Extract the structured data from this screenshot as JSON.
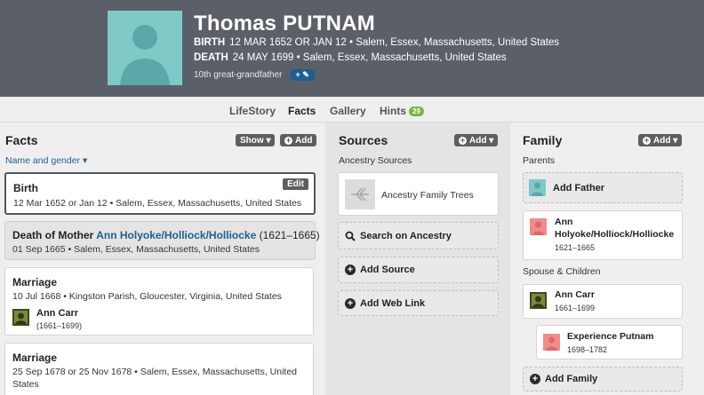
{
  "person": {
    "name": "Thomas PUTNAM",
    "birth_label": "BIRTH",
    "birth_value": "12 MAR 1652 OR JAN 12 • Salem, Essex, Massachusetts, United States",
    "death_label": "DEATH",
    "death_value": "24 MAY 1699 • Salem, Essex, Massachusetts, United States",
    "relationship": "10th great-grandfather",
    "relationship_button": "+ ✎"
  },
  "tabs": [
    {
      "label": "LifeStory"
    },
    {
      "label": "Facts"
    },
    {
      "label": "Gallery"
    },
    {
      "label": "Hints",
      "badge": "29"
    }
  ],
  "facts": {
    "title": "Facts",
    "show_label": "Show ▾",
    "add_label": "Add",
    "name_gender": "Name and gender ▾",
    "edit_label": "Edit",
    "items": [
      {
        "title": "Birth",
        "detail": "12 Mar 1652 or Jan 12 • Salem, Essex, Massachusetts, United States"
      },
      {
        "title_prefix": "Death of Mother ",
        "title_link": "Ann Holyoke/Holliock/Holliocke",
        "title_suffix": " (1621–1665)",
        "detail": "01 Sep 1665 • Salem, Essex, Massachusetts, United States"
      },
      {
        "title": "Marriage",
        "detail": "10 Jul 1668 • Kingston Parish, Gloucester, Virginia, United States",
        "spouse_name": "Ann Carr",
        "spouse_dates": "(1661–1699)"
      },
      {
        "title": "Marriage",
        "detail": "25 Sep 1678 or 25 Nov 1678 • Salem, Essex, Massachusetts, United",
        "detail2": "States"
      }
    ]
  },
  "sources": {
    "title": "Sources",
    "add_label": "Add ▾",
    "sub": "Ancestry Sources",
    "tree_label": "Ancestry Family Trees",
    "search_label": "Search on Ancestry",
    "add_source": "Add Source",
    "add_web_link": "Add Web Link"
  },
  "family": {
    "title": "Family",
    "add_label": "Add ▾",
    "parents_label": "Parents",
    "add_father": "Add Father",
    "mother_name_1": "Ann",
    "mother_name_2": "Holyoke/Holliock/Holliocke",
    "mother_dates": "1621–1665",
    "spouse_children_label": "Spouse & Children",
    "spouse_name": "Ann Carr",
    "spouse_dates": "1661–1699",
    "child_name": "Experience Putnam",
    "child_dates": "1698–1782",
    "add_family": "Add Family"
  },
  "colors": {
    "header_bg": "#5b6068",
    "accent_green": "#7ab342",
    "link_blue": "#1e5f8f",
    "male_avatar": "#7fc9c9",
    "female_avatar": "#f28b8b"
  }
}
